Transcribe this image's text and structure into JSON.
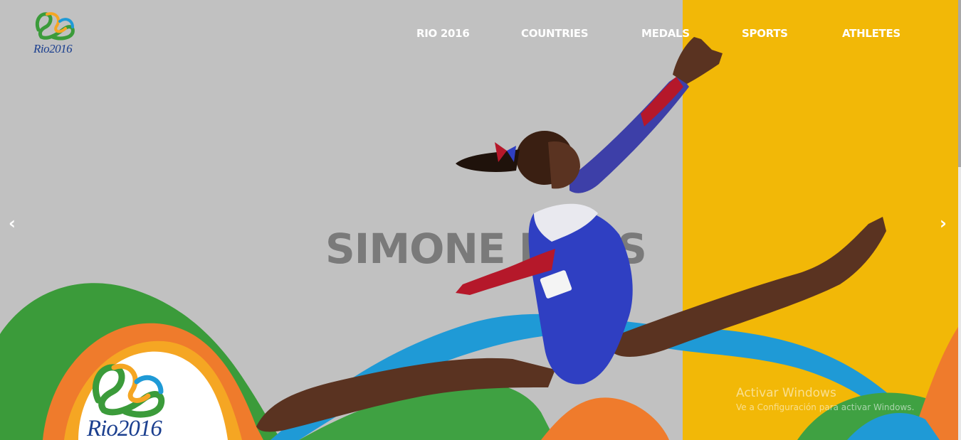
{
  "brand": {
    "logo_text": "Rio2016",
    "icon": "rio-2016-logo-icon"
  },
  "nav": {
    "items": [
      {
        "label": "RIO 2016"
      },
      {
        "label": "COUNTRIES"
      },
      {
        "label": "MEDALS"
      },
      {
        "label": "SPORTS"
      },
      {
        "label": "ATHLETES"
      }
    ]
  },
  "slider": {
    "title": "SIMONE BILES",
    "prev_icon": "‹",
    "next_icon": "›",
    "badge_logo_text": "Rio2016"
  },
  "watermark": {
    "line1": "Activar Windows",
    "line2": "Ve a Configuración para activar Windows."
  },
  "colors": {
    "background": "#c1c1c1",
    "accent_yellow": "#f2b807",
    "ribbon_green": "#3a9a3a",
    "ribbon_orange": "#ee7a2b",
    "ribbon_blue": "#1f9ad6",
    "leotard_blue": "#2f3fc2",
    "leotard_red": "#b5182a"
  }
}
